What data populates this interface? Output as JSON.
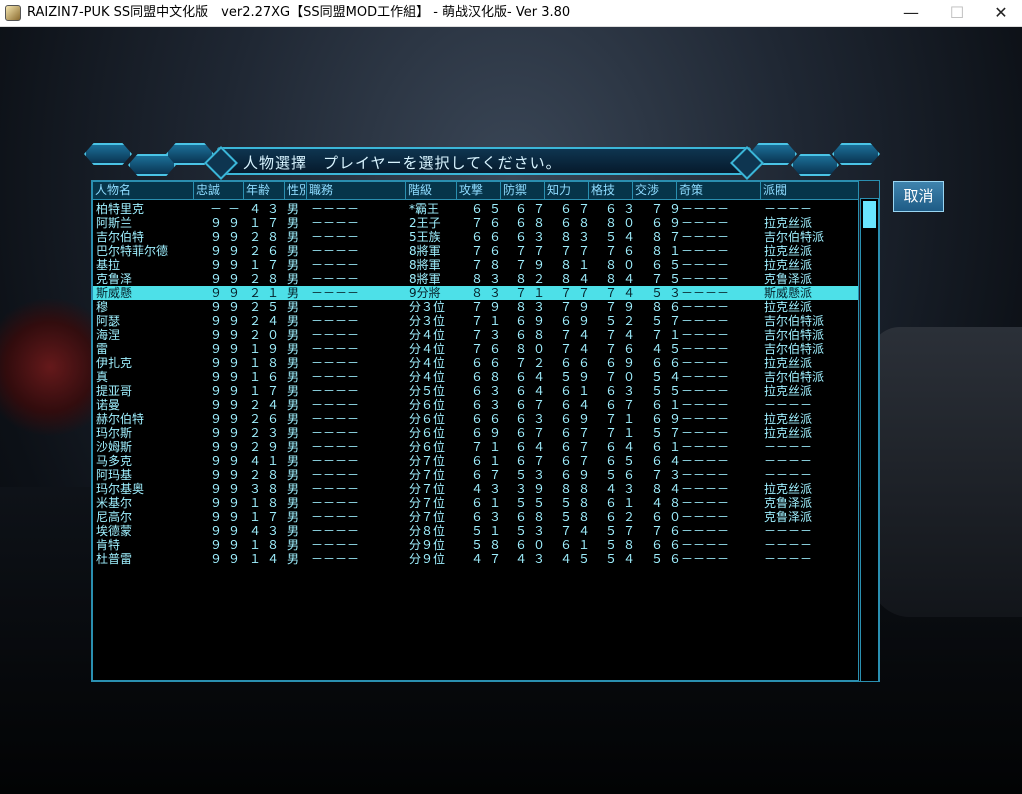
{
  "window": {
    "title": "RAIZIN7-PUK SS同盟中文化版　ver2.27XG【SS同盟MOD工作組】 - 萌战汉化版- Ver 3.80",
    "minimize_label": "—",
    "maximize_label": "☐",
    "close_label": "✕"
  },
  "dialog": {
    "banner_text": "人物選擇　プレイヤーを選択してください。",
    "cancel_label": "取消"
  },
  "table": {
    "headers": [
      "人物名",
      "忠誠",
      "年齢",
      "性別",
      "職務",
      "階級",
      "攻撃",
      "防禦",
      "知力",
      "格技",
      "交渉",
      "奇策",
      "派閥"
    ],
    "selected_index": 6,
    "rows": [
      {
        "name": "柏特里克",
        "loyalty": "－－",
        "age": "４３",
        "sex": "男",
        "duty": "－－－－",
        "rank": "*霸王",
        "atk": "６５",
        "def": "６７",
        "int": "６７",
        "melee": "６３",
        "neg": "７９",
        "trick": "－－－－",
        "faction": "－－－－"
      },
      {
        "name": "阿斯兰",
        "loyalty": "９９",
        "age": "１７",
        "sex": "男",
        "duty": "－－－－",
        "rank": "2王子",
        "atk": "７６",
        "def": "６８",
        "int": "６８",
        "melee": "８０",
        "neg": "６９",
        "trick": "－－－－",
        "faction": "拉克丝派"
      },
      {
        "name": "吉尔伯特",
        "loyalty": "９９",
        "age": "２８",
        "sex": "男",
        "duty": "－－－－",
        "rank": "5王族",
        "atk": "６６",
        "def": "６３",
        "int": "８３",
        "melee": "５４",
        "neg": "８７",
        "trick": "－－－－",
        "faction": "吉尔伯特派"
      },
      {
        "name": "巴尔特菲尔德",
        "loyalty": "９９",
        "age": "２６",
        "sex": "男",
        "duty": "－－－－",
        "rank": "8將軍",
        "atk": "７６",
        "def": "７７",
        "int": "７７",
        "melee": "７６",
        "neg": "８１",
        "trick": "－－－－",
        "faction": "拉克丝派"
      },
      {
        "name": "基拉",
        "loyalty": "９９",
        "age": "１７",
        "sex": "男",
        "duty": "－－－－",
        "rank": "8將軍",
        "atk": "７８",
        "def": "７９",
        "int": "８１",
        "melee": "８０",
        "neg": "６５",
        "trick": "－－－－",
        "faction": "拉克丝派"
      },
      {
        "name": "克鲁泽",
        "loyalty": "９９",
        "age": "２８",
        "sex": "男",
        "duty": "－－－－",
        "rank": "8將軍",
        "atk": "８３",
        "def": "８２",
        "int": "８４",
        "melee": "８４",
        "neg": "７５",
        "trick": "－－－－",
        "faction": "克鲁泽派"
      },
      {
        "name": "斯威懸",
        "loyalty": "９９",
        "age": "２１",
        "sex": "男",
        "duty": "－－－－",
        "rank": "9分將",
        "atk": "８３",
        "def": "７１",
        "int": "７７",
        "melee": "７４",
        "neg": "５３",
        "trick": "－－－－",
        "faction": "斯威懸派"
      },
      {
        "name": "穆",
        "loyalty": "９９",
        "age": "２５",
        "sex": "男",
        "duty": "－－－－",
        "rank": "分３位",
        "atk": "７９",
        "def": "８３",
        "int": "７９",
        "melee": "７９",
        "neg": "８６",
        "trick": "－－－－",
        "faction": "拉克丝派"
      },
      {
        "name": "阿瑟",
        "loyalty": "９９",
        "age": "２４",
        "sex": "男",
        "duty": "－－－－",
        "rank": "分３位",
        "atk": "７１",
        "def": "６９",
        "int": "６９",
        "melee": "５２",
        "neg": "５７",
        "trick": "－－－－",
        "faction": "吉尔伯特派"
      },
      {
        "name": "海涅",
        "loyalty": "９９",
        "age": "２０",
        "sex": "男",
        "duty": "－－－－",
        "rank": "分４位",
        "atk": "７３",
        "def": "６８",
        "int": "７４",
        "melee": "７４",
        "neg": "７１",
        "trick": "－－－－",
        "faction": "吉尔伯特派"
      },
      {
        "name": "雷",
        "loyalty": "９９",
        "age": "１９",
        "sex": "男",
        "duty": "－－－－",
        "rank": "分４位",
        "atk": "７６",
        "def": "８０",
        "int": "７４",
        "melee": "７６",
        "neg": "４５",
        "trick": "－－－－",
        "faction": "吉尔伯特派"
      },
      {
        "name": "伊扎克",
        "loyalty": "９９",
        "age": "１８",
        "sex": "男",
        "duty": "－－－－",
        "rank": "分４位",
        "atk": "６６",
        "def": "７２",
        "int": "６６",
        "melee": "６９",
        "neg": "６６",
        "trick": "－－－－",
        "faction": "拉克丝派"
      },
      {
        "name": "真",
        "loyalty": "９９",
        "age": "１６",
        "sex": "男",
        "duty": "－－－－",
        "rank": "分４位",
        "atk": "６８",
        "def": "６４",
        "int": "５９",
        "melee": "７０",
        "neg": "５４",
        "trick": "－－－－",
        "faction": "吉尔伯特派"
      },
      {
        "name": "提亚哥",
        "loyalty": "９９",
        "age": "１７",
        "sex": "男",
        "duty": "－－－－",
        "rank": "分５位",
        "atk": "６３",
        "def": "６４",
        "int": "６１",
        "melee": "６３",
        "neg": "５５",
        "trick": "－－－－",
        "faction": "拉克丝派"
      },
      {
        "name": "诺曼",
        "loyalty": "９９",
        "age": "２４",
        "sex": "男",
        "duty": "－－－－",
        "rank": "分６位",
        "atk": "６３",
        "def": "６７",
        "int": "６４",
        "melee": "６７",
        "neg": "６１",
        "trick": "－－－－",
        "faction": "－－－－"
      },
      {
        "name": "赫尔伯特",
        "loyalty": "９９",
        "age": "２６",
        "sex": "男",
        "duty": "－－－－",
        "rank": "分６位",
        "atk": "６６",
        "def": "６３",
        "int": "６９",
        "melee": "７１",
        "neg": "６９",
        "trick": "－－－－",
        "faction": "拉克丝派"
      },
      {
        "name": "玛尔斯",
        "loyalty": "９９",
        "age": "２３",
        "sex": "男",
        "duty": "－－－－",
        "rank": "分６位",
        "atk": "６９",
        "def": "６７",
        "int": "６７",
        "melee": "７１",
        "neg": "５７",
        "trick": "－－－－",
        "faction": "拉克丝派"
      },
      {
        "name": "沙姆斯",
        "loyalty": "９９",
        "age": "２９",
        "sex": "男",
        "duty": "－－－－",
        "rank": "分６位",
        "atk": "７１",
        "def": "６４",
        "int": "６７",
        "melee": "６４",
        "neg": "６１",
        "trick": "－－－－",
        "faction": "－－－－"
      },
      {
        "name": "马多克",
        "loyalty": "９９",
        "age": "４１",
        "sex": "男",
        "duty": "－－－－",
        "rank": "分７位",
        "atk": "６１",
        "def": "６７",
        "int": "６７",
        "melee": "６５",
        "neg": "６４",
        "trick": "－－－－",
        "faction": "－－－－"
      },
      {
        "name": "阿玛基",
        "loyalty": "９９",
        "age": "２８",
        "sex": "男",
        "duty": "－－－－",
        "rank": "分７位",
        "atk": "６７",
        "def": "５３",
        "int": "６９",
        "melee": "５６",
        "neg": "７３",
        "trick": "－－－－",
        "faction": "－－－－"
      },
      {
        "name": "玛尔基奥",
        "loyalty": "９９",
        "age": "３８",
        "sex": "男",
        "duty": "－－－－",
        "rank": "分７位",
        "atk": "４３",
        "def": "３９",
        "int": "８８",
        "melee": "４３",
        "neg": "８４",
        "trick": "－－－－",
        "faction": "拉克丝派"
      },
      {
        "name": "米基尔",
        "loyalty": "９９",
        "age": "１８",
        "sex": "男",
        "duty": "－－－－",
        "rank": "分７位",
        "atk": "６１",
        "def": "５５",
        "int": "５８",
        "melee": "６１",
        "neg": "４８",
        "trick": "－－－－",
        "faction": "克鲁泽派"
      },
      {
        "name": "尼高尔",
        "loyalty": "９９",
        "age": "１７",
        "sex": "男",
        "duty": "－－－－",
        "rank": "分７位",
        "atk": "６３",
        "def": "６８",
        "int": "５８",
        "melee": "６２",
        "neg": "６０",
        "trick": "－－－－",
        "faction": "克鲁泽派"
      },
      {
        "name": "埃德蒙",
        "loyalty": "９９",
        "age": "４３",
        "sex": "男",
        "duty": "－－－－",
        "rank": "分８位",
        "atk": "５１",
        "def": "５３",
        "int": "７４",
        "melee": "５７",
        "neg": "７６",
        "trick": "－－－－",
        "faction": "－－－－"
      },
      {
        "name": "肯特",
        "loyalty": "９９",
        "age": "１８",
        "sex": "男",
        "duty": "－－－－",
        "rank": "分９位",
        "atk": "５８",
        "def": "６０",
        "int": "６１",
        "melee": "５８",
        "neg": "６６",
        "trick": "－－－－",
        "faction": "－－－－"
      },
      {
        "name": "杜普雷",
        "loyalty": "９９",
        "age": "１４",
        "sex": "男",
        "duty": "－－－－",
        "rank": "分９位",
        "atk": "４７",
        "def": "４３",
        "int": "４５",
        "melee": "５４",
        "neg": "５６",
        "trick": "－－－－",
        "faction": "－－－－"
      }
    ]
  }
}
